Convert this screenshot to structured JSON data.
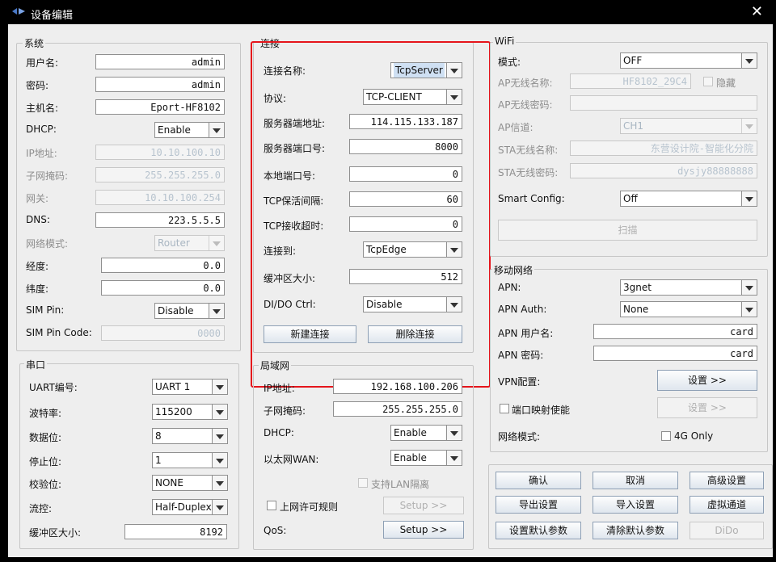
{
  "window": {
    "title": "设备编辑",
    "close_glyph": "✕",
    "app_icon": "network-icon"
  },
  "system": {
    "title": "系统",
    "username_label": "用户名:",
    "username": "admin",
    "password_label": "密码:",
    "password": "admin",
    "hostname_label": "主机名:",
    "hostname": "Eport-HF8102",
    "dhcp_label": "DHCP:",
    "dhcp": "Enable",
    "ip_label": "IP地址:",
    "ip": "10.10.100.10",
    "mask_label": "子网掩码:",
    "mask": "255.255.255.0",
    "gateway_label": "网关:",
    "gateway": "10.10.100.254",
    "dns_label": "DNS:",
    "dns": "223.5.5.5",
    "netmode_label": "网络模式:",
    "netmode": "Router",
    "lon_label": "经度:",
    "lon": "0.0",
    "lat_label": "纬度:",
    "lat": "0.0",
    "simpin_label": "SIM Pin:",
    "simpin": "Disable",
    "simcode_label": "SIM Pin Code:",
    "simcode": "0000"
  },
  "serial": {
    "title": "串口",
    "uart_label": "UART编号:",
    "uart": "UART 1",
    "baud_label": "波特率:",
    "baud": "115200",
    "databits_label": "数据位:",
    "databits": "8",
    "stopbits_label": "停止位:",
    "stopbits": "1",
    "parity_label": "校验位:",
    "parity": "NONE",
    "flow_label": "流控:",
    "flow": "Half-Duplex",
    "buf_label": "缓冲区大小:",
    "buf": "8192"
  },
  "connection": {
    "title": "连接",
    "name_label": "连接名称:",
    "name": "TcpServer",
    "proto_label": "协议:",
    "proto": "TCP-CLIENT",
    "server_addr_label": "服务器端地址:",
    "server_addr": "114.115.133.187",
    "server_port_label": "服务器端口号:",
    "server_port": "8000",
    "local_port_label": "本地端口号:",
    "local_port": "0",
    "keepalive_label": "TCP保活间隔:",
    "keepalive": "60",
    "timeout_label": "TCP接收超时:",
    "timeout": "0",
    "connect_to_label": "连接到:",
    "connect_to": "TcpEdge",
    "buf_label": "缓冲区大小:",
    "buf": "512",
    "dido_label": "DI/DO Ctrl:",
    "dido": "Disable",
    "new_btn": "新建连接",
    "delete_btn": "删除连接"
  },
  "lan": {
    "title": "局域网",
    "ip_label": "IP地址:",
    "ip": "192.168.100.206",
    "mask_label": "子网掩码:",
    "mask": "255.255.255.0",
    "dhcp_label": "DHCP:",
    "dhcp": "Enable",
    "wan_label": "以太网WAN:",
    "wan": "Enable",
    "isolate_label": "支持LAN隔离",
    "access_rule_label": "上网许可规则",
    "access_setup_btn": "Setup >>",
    "qos_label": "QoS:",
    "qos_setup_btn": "Setup >>"
  },
  "wifi": {
    "title": "WiFi",
    "mode_label": "模式:",
    "mode": "OFF",
    "ap_ssid_label": "AP无线名称:",
    "ap_ssid": "HF8102_29C4",
    "hide_label": "隐藏",
    "ap_pwd_label": "AP无线密码:",
    "ap_pwd": "",
    "ap_channel_label": "AP信道:",
    "ap_channel": "CH1",
    "sta_ssid_label": "STA无线名称:",
    "sta_ssid": "东营设计院-智能化分院",
    "sta_pwd_label": "STA无线密码:",
    "sta_pwd": "dysjy88888888",
    "smart_label": "Smart Config:",
    "smart": "Off",
    "scan_btn": "扫描"
  },
  "mobile": {
    "title": "移动网络",
    "apn_label": "APN:",
    "apn": "3gnet",
    "apn_auth_label": "APN Auth:",
    "apn_auth": "None",
    "apn_user_label": "APN 用户名:",
    "apn_user": "card",
    "apn_pwd_label": "APN 密码:",
    "apn_pwd": "card",
    "vpn_label": "VPN配置:",
    "vpn_btn": "设置 >>",
    "portmap_label": "端口映射使能",
    "portmap_btn": "设置 >>",
    "netmode_label": "网络模式:",
    "only4g_label": "4G Only"
  },
  "actions": {
    "confirm": "确认",
    "cancel": "取消",
    "advanced": "高级设置",
    "export": "导出设置",
    "import": "导入设置",
    "virtual": "虚拟通道",
    "set_default": "设置默认参数",
    "clear_default": "清除默认参数",
    "dido": "DiDo"
  }
}
